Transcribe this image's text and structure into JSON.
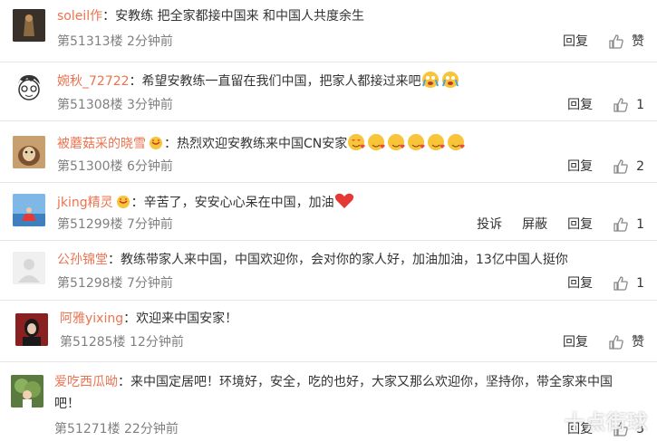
{
  "comments": [
    {
      "user": "soleil作",
      "text": "安教练 把全家都接中国来 和中国人共度余生",
      "floor": "第51313楼",
      "time": "2分钟前",
      "actions": [
        "回复"
      ],
      "likes": "赞"
    },
    {
      "user": "婉秋_72722",
      "text": "希望安教练一直留在我们中国，把家人都接过来吧",
      "floor": "第51308楼",
      "time": "3分钟前",
      "actions": [
        "回复"
      ],
      "likes": "1"
    },
    {
      "user": "被蘑菇采的晓雪",
      "text": "热烈欢迎安教练来中国CN安家",
      "floor": "第51300楼",
      "time": "6分钟前",
      "actions": [
        "回复"
      ],
      "likes": "2"
    },
    {
      "user": "jking精灵",
      "text": "辛苦了，安安心心呆在中国，加油",
      "floor": "第51299楼",
      "time": "7分钟前",
      "actions": [
        "投诉",
        "屏蔽",
        "回复"
      ],
      "likes": "1"
    },
    {
      "user": "公孙锦堂",
      "text": "教练带家人来中国，中国欢迎你，会对你的家人好，加油加油，13亿中国人挺你",
      "floor": "第51298楼",
      "time": "7分钟前",
      "actions": [
        "回复"
      ],
      "likes": "1"
    },
    {
      "user": "阿雅yixing",
      "text": "欢迎来中国安家！",
      "floor": "第51285楼",
      "time": "12分钟前",
      "actions": [
        "回复"
      ],
      "likes": "赞"
    },
    {
      "user": "爱吃西瓜呦",
      "text": "来中国定居吧！环境好，安全，吃的也好，大家又那么欢迎你，坚持你，带全家来中国吧！",
      "floor": "第51271楼",
      "time": "22分钟前",
      "actions": [
        "回复"
      ],
      "likes": "3"
    }
  ],
  "watermark": "十点街球",
  "colors": {
    "username": "#eb7350",
    "meta": "#808080",
    "text": "#333333",
    "divider": "#e6e6e6"
  }
}
